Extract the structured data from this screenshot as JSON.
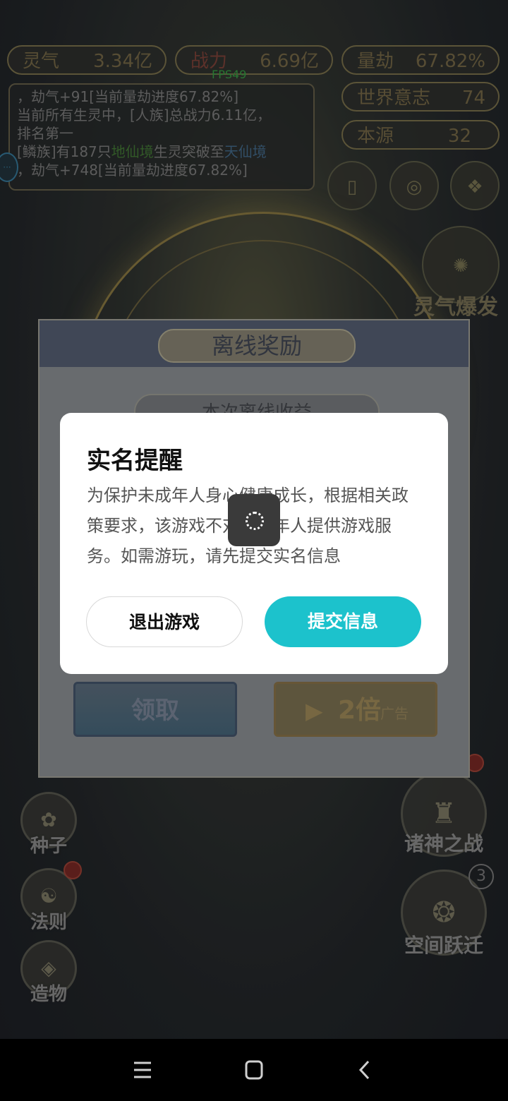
{
  "stats": {
    "lingqi": {
      "label": "灵气",
      "value": "3.34亿"
    },
    "zhanli": {
      "label": "战力",
      "value": "6.69亿"
    },
    "liangjie": {
      "label": "量劫",
      "value": "67.82%"
    },
    "world_will": {
      "label": "世界意志",
      "value": "74"
    },
    "benyuan": {
      "label": "本源",
      "value": "32"
    }
  },
  "fps": "FPS49",
  "log": {
    "line1": "，劫气+91[当前量劫进度67.82%]",
    "line2": "当前所有生灵中，[人族]总战力6.11亿，",
    "line3": "排名第一",
    "line4_a": "[鳞族]有187只",
    "line4_b": "地仙境",
    "line4_c": "生灵突破至",
    "line4_d": "天仙境",
    "line5": "，劫气+748[当前量劫进度67.82%]"
  },
  "burst_label": "灵气爆发",
  "left_buttons": [
    "种子",
    "法则",
    "造物"
  ],
  "right_buttons": [
    "诸神之战",
    "空间跃迁"
  ],
  "right_badge": "3",
  "reward": {
    "title": "离线奖励",
    "subtitle": "本次离线收益",
    "claim": "领取",
    "double": "2倍",
    "ad": "广告"
  },
  "modal": {
    "title": "实名提醒",
    "body": "为保护未成年人身心健康成长，根据相关政策要求，该游戏不对未成年人提供游戏服务。如需游玩，请先提交实名信息",
    "exit_button": "退出游戏",
    "submit_button": "提交信息"
  },
  "colors": {
    "accent": "#1cc2cc",
    "modal_bg": "#ffffff",
    "nav_bg": "#000000"
  },
  "icons": {
    "menu": "menu-icon",
    "home": "home-icon",
    "back": "back-icon"
  }
}
